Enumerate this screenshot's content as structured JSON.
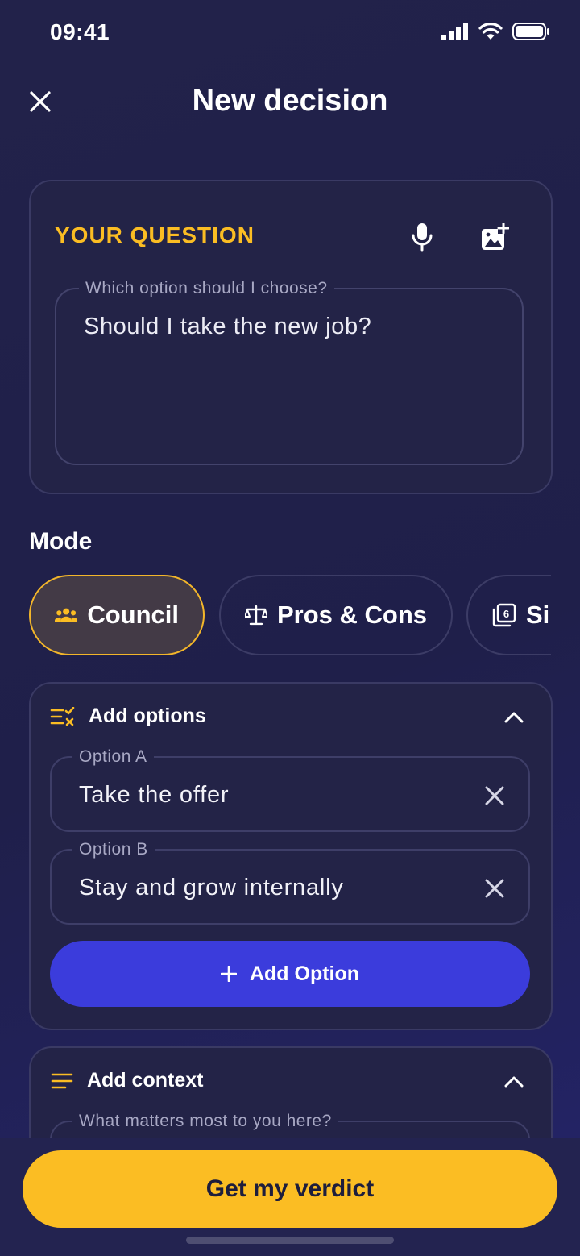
{
  "status_bar": {
    "time": "09:41"
  },
  "header": {
    "title": "New decision"
  },
  "question": {
    "label": "YOUR QUESTION",
    "field_label": "Which option should I choose?",
    "value": "Should I take the new job?"
  },
  "mode": {
    "title": "Mode",
    "chips": [
      {
        "label": "Council",
        "icon": "people-icon",
        "selected": true
      },
      {
        "label": "Pros & Cons",
        "icon": "scale-icon",
        "selected": false
      },
      {
        "label": "Si",
        "icon": "dice-six-icon",
        "selected": false
      }
    ]
  },
  "options": {
    "title": "Add options",
    "items": [
      {
        "label": "Option A",
        "value": "Take the offer"
      },
      {
        "label": "Option B",
        "value": "Stay and grow internally"
      }
    ],
    "add_label": "Add Option"
  },
  "context": {
    "title": "Add context",
    "field_label": "What matters most to you here?"
  },
  "cta": {
    "label": "Get my verdict"
  },
  "colors": {
    "accent": "#fbbd23",
    "primary": "#3b3cdc",
    "background": "#22224a"
  }
}
